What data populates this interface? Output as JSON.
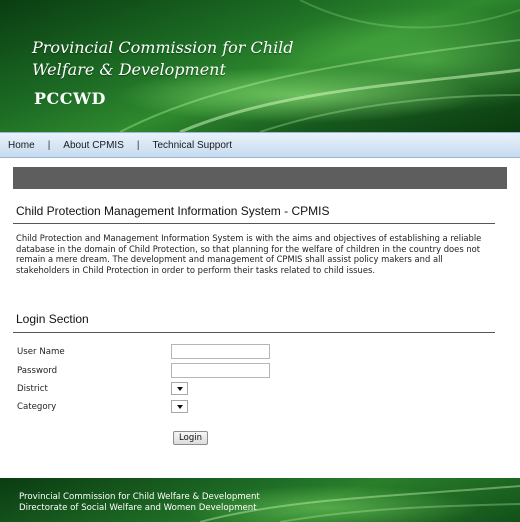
{
  "header": {
    "title": "Provincial Commission for Child Welfare & Development",
    "abbreviation": "PCCWD"
  },
  "nav": {
    "items": [
      "Home",
      "About CPMIS",
      "Technical Support"
    ],
    "separator": "|"
  },
  "intro": {
    "heading": "Child Protection Management Information System - CPMIS",
    "description": "Child Protection and Management Information System is with the aims and objectives of establishing a reliable database in the domain of Child Protection, so that planning for the welfare of children in the country does not remain a mere dream. The development and management of CPMIS shall assist policy makers and all stakeholders in Child Protection in order to perform their tasks related to child issues."
  },
  "login": {
    "heading": "Login Section",
    "username_label": "User Name",
    "username_value": "",
    "password_label": "Password",
    "password_value": "",
    "district_label": "District",
    "district_selected": "",
    "category_label": "Category",
    "category_selected": "",
    "button_label": "Login"
  },
  "footer": {
    "line1": "Provincial Commission for Child Welfare & Development",
    "line2": "Directorate of Social Welfare and Women Development"
  },
  "colors": {
    "banner_green": "#1c6b24",
    "nav_blue": "#c6dbef",
    "grey_bar": "#5e5e5e"
  }
}
